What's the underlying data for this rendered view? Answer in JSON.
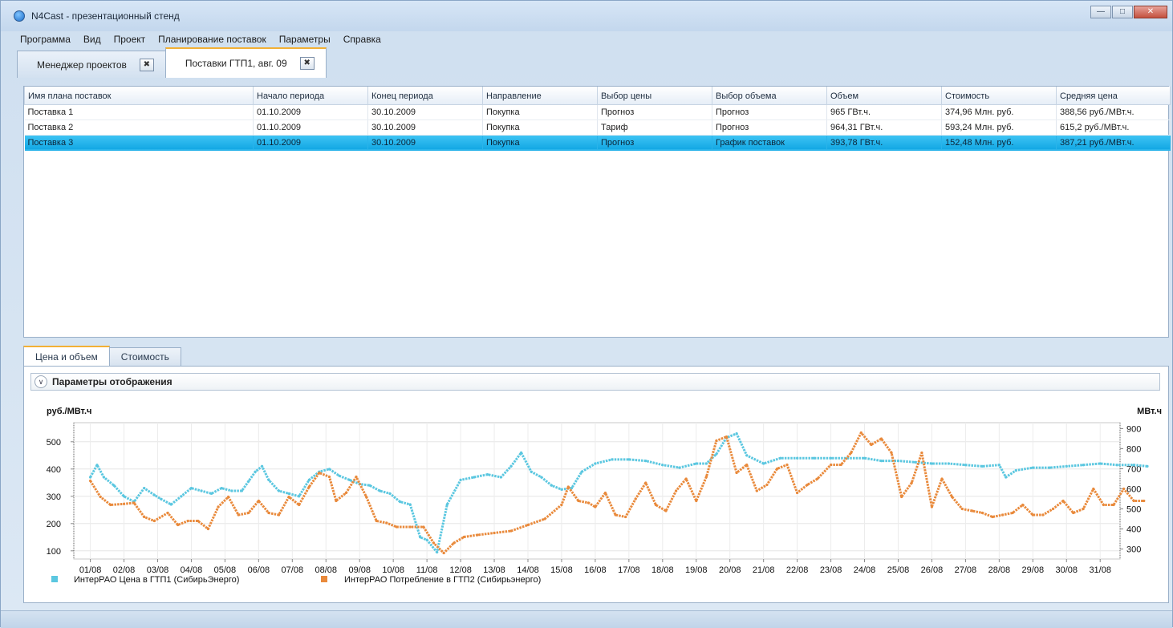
{
  "window": {
    "title": "N4Cast - презентационный стенд"
  },
  "menu": [
    "Программа",
    "Вид",
    "Проект",
    "Планирование поставок",
    "Параметры",
    "Справка"
  ],
  "doc_tabs": [
    {
      "label": "Менеджер проектов",
      "active": false
    },
    {
      "label": "Поставки ГТП1, авг. 09",
      "active": true
    }
  ],
  "grid": {
    "columns": [
      "Имя плана поставок",
      "Начало периода",
      "Конец периода",
      "Направление",
      "Выбор цены",
      "Выбор объема",
      "Объем",
      "Стоимость",
      "Средняя цена"
    ],
    "rows": [
      [
        "Поставка 1",
        "01.10.2009",
        "30.10.2009",
        "Покупка",
        "Прогноз",
        "Прогноз",
        "965 ГВт.ч.",
        "374,96 Млн. руб.",
        "388,56 руб./МВт.ч."
      ],
      [
        "Поставка 2",
        "01.10.2009",
        "30.10.2009",
        "Покупка",
        "Тариф",
        "Прогноз",
        "964,31 ГВт.ч.",
        "593,24 Млн. руб.",
        "615,2 руб./МВт.ч."
      ],
      [
        "Поставка 3",
        "01.10.2009",
        "30.10.2009",
        "Покупка",
        "Прогноз",
        "График поставок",
        "393,78 ГВт.ч.",
        "152,48 Млн. руб.",
        "387,21 руб./МВт.ч."
      ]
    ],
    "selected_row": 2
  },
  "bottom_tabs": [
    {
      "label": "Цена и объем",
      "active": true
    },
    {
      "label": "Стоимость",
      "active": false
    }
  ],
  "params": {
    "label": "Параметры отображения"
  },
  "chart_data": {
    "type": "line",
    "ylabel_left": "руб./МВт.ч",
    "ylabel_right": "МВт.ч",
    "ylim_left": [
      70,
      570
    ],
    "yticks_left": [
      100,
      200,
      300,
      400,
      500
    ],
    "ylim_right": [
      250,
      930
    ],
    "yticks_right": [
      300,
      400,
      500,
      600,
      700,
      800,
      900
    ],
    "xlabels": [
      "01/08",
      "02/08",
      "03/08",
      "04/08",
      "05/08",
      "06/08",
      "07/08",
      "08/08",
      "09/08",
      "10/08",
      "11/08",
      "12/08",
      "13/08",
      "14/08",
      "15/08",
      "16/08",
      "17/08",
      "18/08",
      "19/08",
      "20/08",
      "21/08",
      "22/08",
      "23/08",
      "24/08",
      "25/08",
      "26/08",
      "27/08",
      "28/08",
      "29/08",
      "30/08",
      "31/08"
    ],
    "grid": true,
    "legend_position": "bottom-left",
    "series": [
      {
        "name": "ИнтерРАО Цена в ГТП1 (СибирьЭнерго)",
        "axis": "left",
        "color": "#5bc7e0",
        "x": [
          0,
          0.2,
          0.4,
          0.7,
          1,
          1.3,
          1.6,
          1.9,
          2.1,
          2.4,
          2.7,
          3,
          3.3,
          3.6,
          3.9,
          4.2,
          4.5,
          4.7,
          4.9,
          5.1,
          5.3,
          5.6,
          5.9,
          6.2,
          6.5,
          6.8,
          7.1,
          7.4,
          7.7,
          8,
          8.3,
          8.6,
          8.9,
          9.2,
          9.5,
          9.8,
          10,
          10.3,
          10.6,
          11,
          11.4,
          11.8,
          12.2,
          12.5,
          12.8,
          13.1,
          13.4,
          13.7,
          14,
          14.3,
          14.6,
          15,
          15.5,
          16,
          16.5,
          17,
          17.5,
          18,
          18.3,
          18.6,
          18.9,
          19.2,
          19.5,
          20,
          20.5,
          21,
          21.5,
          22,
          22.5,
          23,
          23.5,
          24,
          24.5,
          25,
          25.5,
          26,
          26.5,
          27,
          27.2,
          27.5,
          28,
          28.5,
          29,
          29.5,
          30,
          30.5,
          31,
          31.4
        ],
        "values": [
          370,
          415,
          370,
          340,
          300,
          280,
          330,
          305,
          290,
          270,
          300,
          330,
          320,
          310,
          330,
          320,
          320,
          355,
          390,
          410,
          360,
          320,
          310,
          300,
          360,
          390,
          400,
          375,
          360,
          345,
          340,
          320,
          310,
          280,
          270,
          150,
          140,
          95,
          270,
          360,
          370,
          380,
          370,
          410,
          460,
          390,
          370,
          340,
          325,
          330,
          390,
          420,
          435,
          435,
          430,
          415,
          405,
          420,
          420,
          455,
          515,
          530,
          450,
          420,
          440,
          440,
          440,
          440,
          440,
          440,
          430,
          430,
          425,
          420,
          420,
          415,
          410,
          415,
          370,
          395,
          405,
          405,
          410,
          415,
          420,
          415,
          415,
          410
        ]
      },
      {
        "name": "ИнтерРАО Потребление в ГТП2 (Сибирьэнерго)",
        "axis": "right",
        "color": "#e98a3c",
        "x": [
          0,
          0.3,
          0.6,
          1,
          1.3,
          1.6,
          1.9,
          2.3,
          2.6,
          2.9,
          3.2,
          3.5,
          3.8,
          4.1,
          4.4,
          4.7,
          5,
          5.3,
          5.6,
          5.9,
          6.2,
          6.5,
          6.8,
          7.1,
          7.3,
          7.6,
          7.9,
          8.2,
          8.5,
          8.8,
          9.1,
          9.5,
          9.9,
          10.2,
          10.5,
          10.8,
          11.1,
          11.5,
          12,
          12.5,
          13,
          13.5,
          14,
          14.2,
          14.5,
          14.8,
          15,
          15.3,
          15.6,
          15.9,
          16.2,
          16.5,
          16.8,
          17.1,
          17.4,
          17.7,
          18,
          18.3,
          18.6,
          18.9,
          19.2,
          19.5,
          19.8,
          20.1,
          20.4,
          20.7,
          21,
          21.3,
          21.6,
          22,
          22.3,
          22.6,
          22.9,
          23.2,
          23.5,
          23.8,
          24.1,
          24.4,
          24.7,
          25,
          25.3,
          25.6,
          25.9,
          26.2,
          26.5,
          26.8,
          27.1,
          27.4,
          27.7,
          28,
          28.3,
          28.6,
          28.9,
          29.2,
          29.5,
          29.8,
          30.1,
          30.4,
          30.7,
          31,
          31.3
        ],
        "values": [
          640,
          560,
          520,
          525,
          530,
          460,
          440,
          480,
          420,
          440,
          440,
          400,
          510,
          560,
          470,
          480,
          540,
          480,
          470,
          560,
          520,
          610,
          680,
          660,
          540,
          580,
          660,
          560,
          440,
          430,
          410,
          410,
          410,
          330,
          280,
          330,
          360,
          370,
          380,
          390,
          420,
          450,
          520,
          610,
          540,
          530,
          510,
          580,
          470,
          460,
          550,
          630,
          520,
          490,
          590,
          650,
          540,
          660,
          840,
          860,
          680,
          720,
          590,
          620,
          700,
          720,
          580,
          620,
          650,
          720,
          720,
          780,
          880,
          820,
          850,
          780,
          560,
          630,
          780,
          510,
          650,
          560,
          500,
          490,
          480,
          460,
          470,
          480,
          520,
          470,
          470,
          500,
          540,
          480,
          500,
          600,
          520,
          520,
          600,
          540,
          540
        ]
      }
    ]
  }
}
